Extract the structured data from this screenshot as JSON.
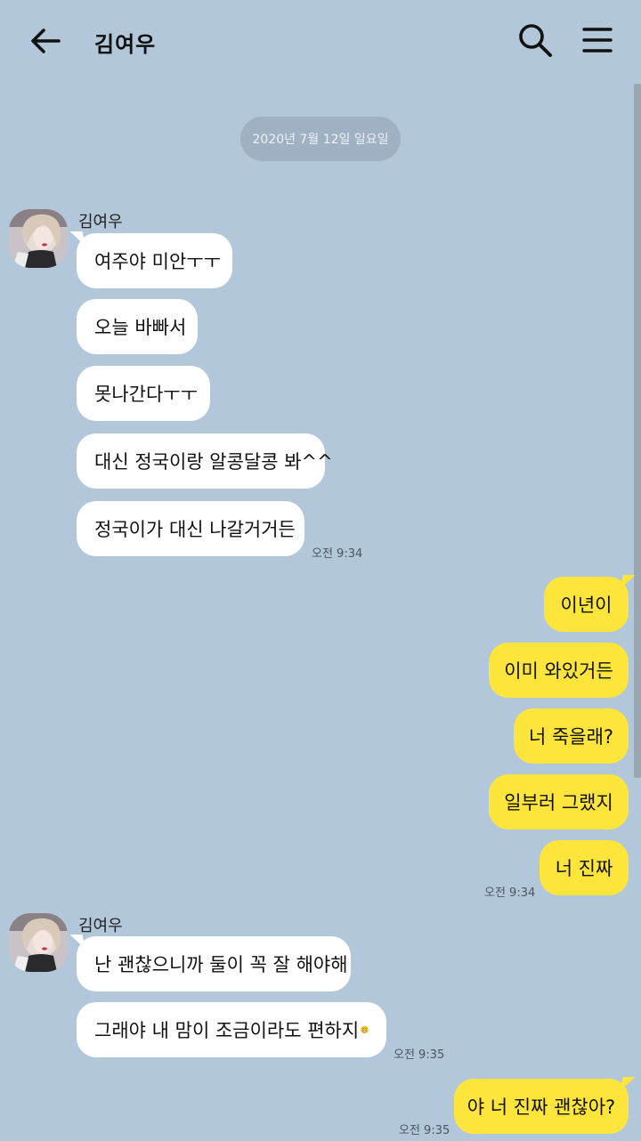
{
  "header": {
    "title": "김여우"
  },
  "date_divider": "2020년 7월 12일 일요일",
  "sender_name": "김여우",
  "messages": {
    "m1": "여주야 미안ㅜㅜ",
    "m2": "오늘 바빠서",
    "m3": "못나간다ㅜㅜ",
    "m4": "대신 정국이랑 알콩달콩 봐^^",
    "m5": "정국이가 대신 나갈거거든",
    "m6": "이년이",
    "m7": "이미 와있거든",
    "m8": "너 죽을래?",
    "m9": "일부러 그랬지",
    "m10": "너 진짜",
    "m11": "난 괜찮으니까 둘이 꼭 잘 해야해",
    "m12": "그래야 내 맘이 조금이라도 편하지",
    "m13": "야 너 진짜 괜찮아?"
  },
  "times": {
    "t1": "오전 9:34",
    "t2": "오전 9:34",
    "t3": "오전 9:35",
    "t4": "오전 9:35"
  },
  "icons": {
    "back": "arrow-left-icon",
    "search": "search-icon",
    "menu": "hamburger-menu-icon",
    "emoji": "grinning-face-emoji"
  },
  "colors": {
    "background": "#b2c7da",
    "outgoing_bubble": "#fee53b",
    "incoming_bubble": "#ffffff"
  }
}
